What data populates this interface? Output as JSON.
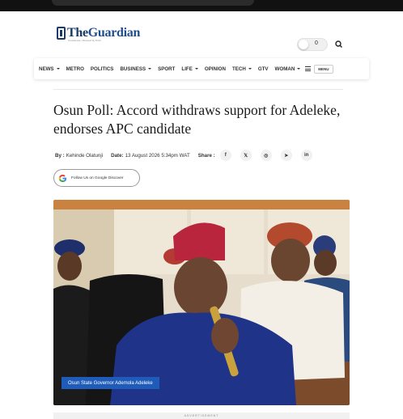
{
  "header": {
    "logo_the": "The",
    "logo_name": "Guardian",
    "logo_tagline": "Conscience, Nurtured by Truth",
    "toggle_value": "0"
  },
  "nav": {
    "items": [
      {
        "label": "NEWS",
        "dropdown": true
      },
      {
        "label": "METRO",
        "dropdown": false
      },
      {
        "label": "POLITICS",
        "dropdown": false
      },
      {
        "label": "BUSINESS",
        "dropdown": true
      },
      {
        "label": "SPORT",
        "dropdown": false
      },
      {
        "label": "LIFE",
        "dropdown": true
      },
      {
        "label": "OPINION",
        "dropdown": false
      },
      {
        "label": "TECH",
        "dropdown": true
      },
      {
        "label": "GTV",
        "dropdown": false
      },
      {
        "label": "WOMAN",
        "dropdown": true
      }
    ],
    "menu_label": "MENU"
  },
  "article": {
    "headline": "Osun Poll: Accord withdraws support for Adeleke, endorses APC candidate",
    "by_label": "By :",
    "author": "Kehinde Olatunji",
    "date_label": "Date:",
    "date": "13 August 2026 5:34pm WAT",
    "share_label": "Share :",
    "share_icons": [
      "facebook-icon",
      "x-icon",
      "whatsapp-icon",
      "telegram-icon",
      "linkedin-icon"
    ],
    "share_glyphs": [
      "f",
      "𝕏",
      "◎",
      "➤",
      "in"
    ],
    "google_follow": "Follow Us on Google Discover",
    "image_caption": "Osun State Governor Ademola Adeleke",
    "ad_label": "ADVERTISEMENT"
  },
  "colors": {
    "brand_blue": "#1f4e8c",
    "caption_blue": "#1f5bb8",
    "status_bar": "#111111"
  }
}
